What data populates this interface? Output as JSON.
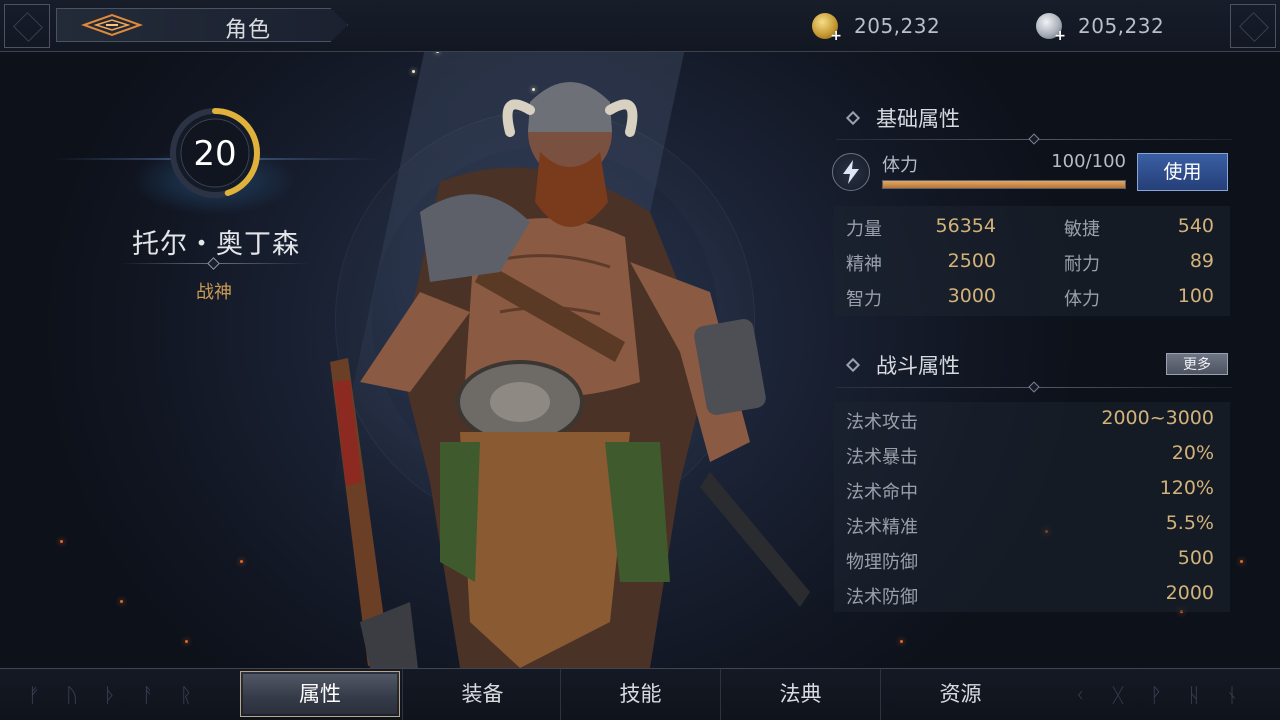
{
  "header": {
    "title": "角色",
    "back_icon": "ornament-back-icon",
    "currencies": [
      {
        "icon": "gold-coin-icon",
        "amount": "205,232",
        "color": "#c79a33"
      },
      {
        "icon": "silver-coin-icon",
        "amount": "205,232",
        "color": "#aab0ba"
      }
    ]
  },
  "hero": {
    "level": "20",
    "level_progress": 0.45,
    "name": "托尔・奥丁森",
    "class": "战神"
  },
  "base_attributes": {
    "title": "基础属性",
    "stamina": {
      "icon": "lightning-icon",
      "label": "体力",
      "value": "100/100",
      "fill": 1.0,
      "use_label": "使用"
    },
    "stats": [
      {
        "left_label": "力量",
        "left_value": "56354",
        "right_label": "敏捷",
        "right_value": "540"
      },
      {
        "left_label": "精神",
        "left_value": "2500",
        "right_label": "耐力",
        "right_value": "89"
      },
      {
        "left_label": "智力",
        "left_value": "3000",
        "right_label": "体力",
        "right_value": "100"
      }
    ]
  },
  "combat_attributes": {
    "title": "战斗属性",
    "more_label": "更多",
    "stats": [
      {
        "label": "法术攻击",
        "value": "2000~3000"
      },
      {
        "label": "法术暴击",
        "value": "20%"
      },
      {
        "label": "法术命中",
        "value": "120%"
      },
      {
        "label": "法术精准",
        "value": "5.5%"
      },
      {
        "label": "物理防御",
        "value": "500"
      },
      {
        "label": "法术防御",
        "value": "2000"
      }
    ]
  },
  "bottom_nav": {
    "tabs": [
      "属性",
      "装备",
      "技能",
      "法典",
      "资源"
    ],
    "active": 0
  },
  "colors": {
    "accent_gold": "#c99a54",
    "stat_value": "#d2b27a",
    "button_blue": "#2f4f8f",
    "stamina_bar": "#d2924c"
  }
}
